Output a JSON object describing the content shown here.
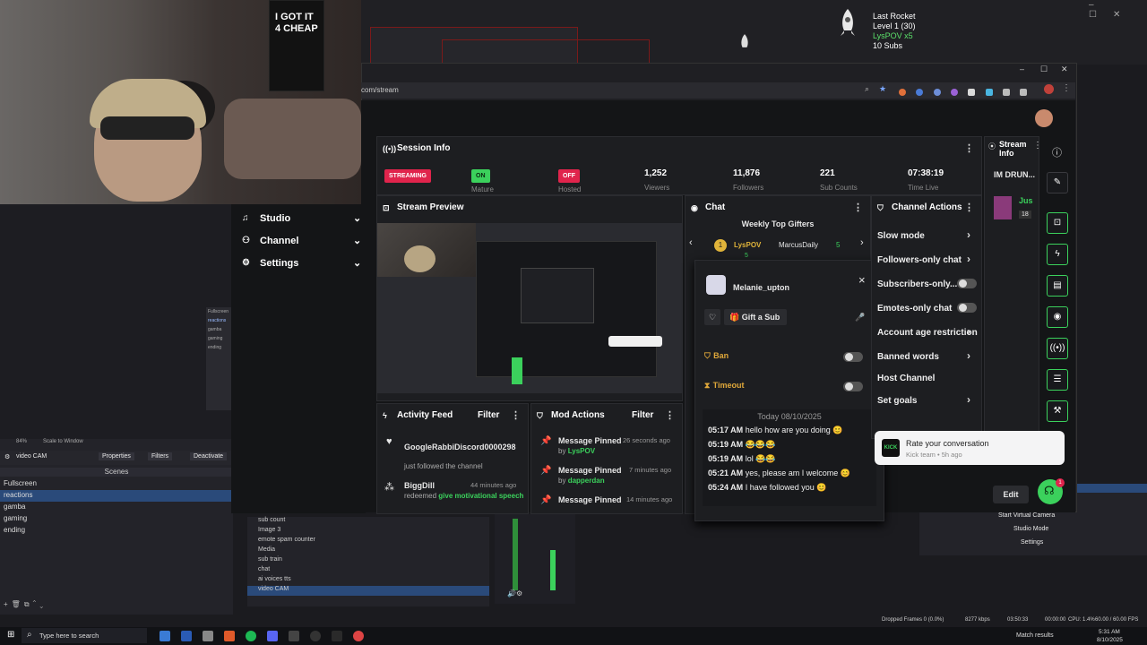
{
  "stream_overlay": {
    "alert_title": "Last Rocket",
    "alert_line1": "Level 1 (30)",
    "alert_line2": "LysPOV x5",
    "alert_line3": "10 Subs"
  },
  "webcam": {
    "poster_text": "I GOT IT 4 CHEAP"
  },
  "browser": {
    "url": "com/stream",
    "window_controls": [
      "–",
      "☐",
      "✕"
    ]
  },
  "session_info": {
    "title": "Session Info",
    "stats": [
      {
        "badge": "STREAMING",
        "label": "",
        "badge_color": "#e0244c"
      },
      {
        "badge": "ON",
        "label": "Mature",
        "badge_color": "#3bd15c"
      },
      {
        "badge": "OFF",
        "label": "Hosted",
        "badge_color": "#e0244c"
      },
      {
        "value": "1,252",
        "label": "Viewers"
      },
      {
        "value": "11,876",
        "label": "Followers"
      },
      {
        "value": "221",
        "label": "Sub Counts"
      },
      {
        "value": "07:38:19",
        "label": "Time Live"
      }
    ]
  },
  "stream_info": {
    "title": "Stream Info",
    "stream_title": "IM DRUN...",
    "category": "Jus",
    "viewer_badge": "18"
  },
  "dashboard_menu": {
    "items": [
      {
        "label": "Studio"
      },
      {
        "label": "Channel"
      },
      {
        "label": "Settings"
      }
    ]
  },
  "stream_preview": {
    "title": "Stream Preview"
  },
  "chat": {
    "title": "Chat",
    "gifters_title": "Weekly Top Gifters",
    "gifters": [
      {
        "rank": "1",
        "name": "LysPOV",
        "count": "5"
      },
      {
        "rank": "2",
        "name": "MarcusDaily",
        "count": "5"
      }
    ],
    "date_divider": "Today 08/10/2025",
    "messages": [
      {
        "time": "05:17 AM",
        "text": "hello how are you doing 😊"
      },
      {
        "time": "05:19 AM",
        "text": "😂😂😂"
      },
      {
        "time": "05:19 AM",
        "text": "lol 😂😂"
      },
      {
        "time": "05:21 AM",
        "text": "yes, please am I welcome 😊"
      },
      {
        "time": "05:24 AM",
        "text": "I have followed you 😊"
      }
    ]
  },
  "user_popup": {
    "username": "Melanie_upton",
    "gift_label": "Gift a Sub",
    "ban_label": "Ban",
    "timeout_label": "Timeout",
    "close": "×"
  },
  "channel_actions": {
    "title": "Channel Actions",
    "rows": [
      {
        "label": "Slow mode",
        "type": "arrow"
      },
      {
        "label": "Followers-only chat",
        "type": "arrow"
      },
      {
        "label": "Subscribers-only...",
        "type": "toggle"
      },
      {
        "label": "Emotes-only chat",
        "type": "toggle"
      },
      {
        "label": "Account age restriction",
        "type": "arrow"
      },
      {
        "label": "Banned words",
        "type": "arrow"
      },
      {
        "label": "Host Channel",
        "type": "none"
      },
      {
        "label": "Set goals",
        "type": "arrow"
      }
    ]
  },
  "activity_feed": {
    "title": "Activity Feed",
    "filter": "Filter",
    "items": [
      {
        "name": "GoogleRabbiDiscord0000298",
        "desc": "just followed the channel",
        "time": ""
      },
      {
        "name": "BiggDill",
        "desc": "redeemed",
        "highlight": "give motivational speech",
        "time": "44 minutes ago"
      }
    ]
  },
  "mod_actions": {
    "title": "Mod Actions",
    "filter": "Filter",
    "items": [
      {
        "title": "Message Pinned",
        "time": "26 seconds ago",
        "by": "by",
        "user": "LysPOV"
      },
      {
        "title": "Message Pinned",
        "time": "7 minutes ago",
        "by": "by",
        "user": "dapperdan"
      },
      {
        "title": "Message Pinned",
        "time": "14 minutes ago",
        "by": "",
        "user": ""
      }
    ]
  },
  "toast": {
    "title": "Rate your conversation",
    "subtitle": "Kick team • 5h ago",
    "logo": "KICK"
  },
  "edit_button": "Edit",
  "notif_count": "1",
  "obs": {
    "zoom": "84%",
    "scale_label": "Scale to Window",
    "source_selected": "video CAM",
    "properties": "Properties",
    "filters": "Filters",
    "deactivate": "Deactivate",
    "scenes_header": "Scenes",
    "scenes": [
      "Fullscreen",
      "reactions",
      "gamba",
      "gaming",
      "ending"
    ],
    "mini_scenes": [
      "Fullscreen",
      "reactions",
      "gamba",
      "gaming",
      "ending"
    ],
    "sources": [
      "sub count",
      "Image 3",
      "emote spam counter",
      "Media",
      "sub train",
      "chat",
      "ai voices tts",
      "video CAM"
    ],
    "controls": [
      "Start Virtual Camera",
      "Studio Mode",
      "Settings"
    ],
    "status": {
      "dropped": "Dropped Frames 0 (0.0%)",
      "bitrate": "8277 kbps",
      "live_time": "03:50:33",
      "rec_time": "00:00:00",
      "cpu": "CPU: 1.4%",
      "fps": "60.00 / 60.00 FPS"
    }
  },
  "taskbar": {
    "search_placeholder": "Type here to search",
    "match_results": "Match results",
    "time": "5:31 AM",
    "date": "8/10/2025"
  }
}
